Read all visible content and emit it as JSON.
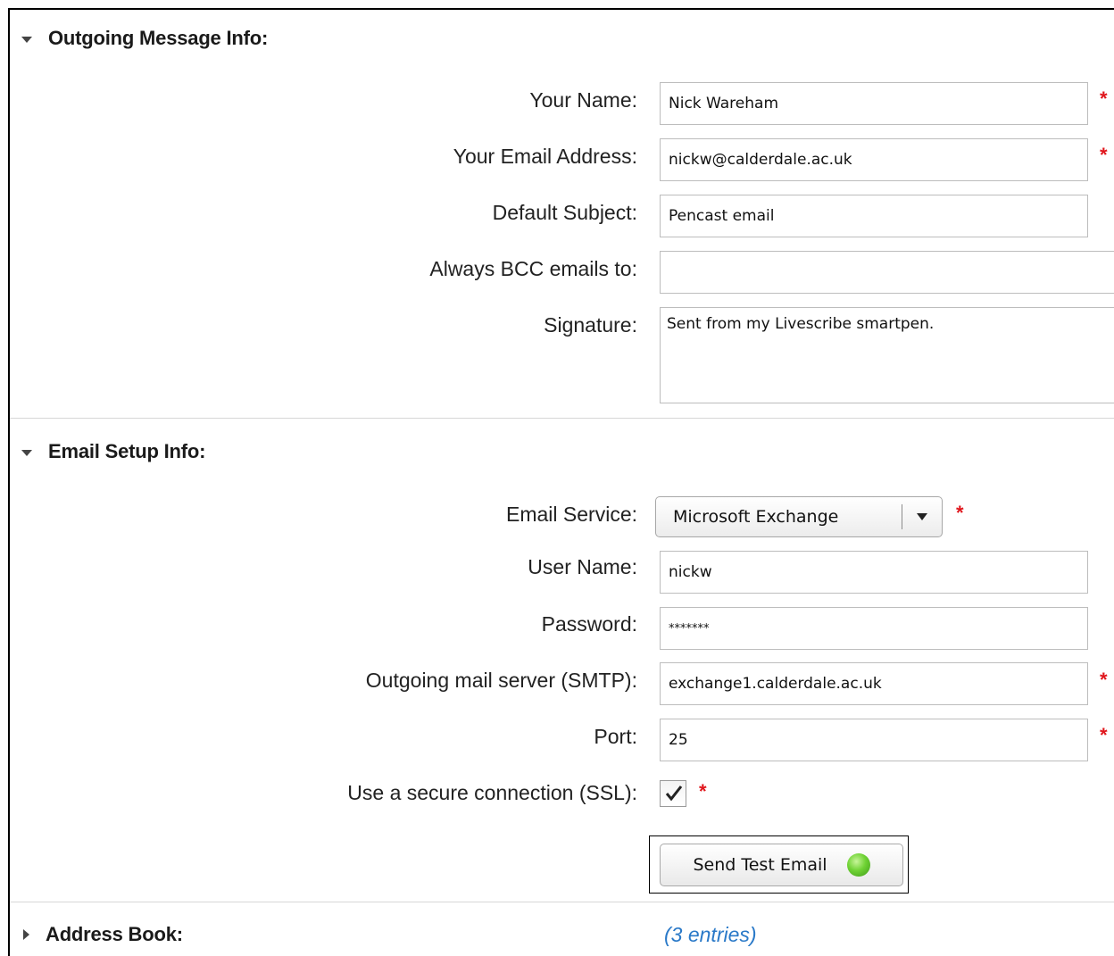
{
  "sections": {
    "outgoing": {
      "title": "Outgoing Message Info:"
    },
    "setup": {
      "title": "Email Setup Info:"
    },
    "address_book": {
      "title": "Address Book:",
      "entries_link": "(3 entries)"
    }
  },
  "outgoing": {
    "name": {
      "label": "Your Name:",
      "value": "Nick Wareham",
      "required": true
    },
    "email": {
      "label": "Your Email Address:",
      "value": "nickw@calderdale.ac.uk",
      "required": true
    },
    "subject": {
      "label": "Default Subject:",
      "value": "Pencast email"
    },
    "bcc": {
      "label": "Always BCC emails to:",
      "value": ""
    },
    "signature": {
      "label": "Signature:",
      "value": "Sent from my Livescribe smartpen."
    }
  },
  "setup": {
    "service": {
      "label": "Email Service:",
      "value": "Microsoft Exchange",
      "required": true
    },
    "username": {
      "label": "User Name:",
      "value": "nickw"
    },
    "password": {
      "label": "Password:",
      "value": "*******"
    },
    "smtp": {
      "label": "Outgoing mail server (SMTP):",
      "value": "exchange1.calderdale.ac.uk",
      "required": true
    },
    "port": {
      "label": "Port:",
      "value": "25",
      "required": true
    },
    "ssl": {
      "label": "Use a secure connection (SSL):",
      "checked": true,
      "required": true
    },
    "test_button": {
      "label": "Send Test Email",
      "status_icon": "green-status-dot"
    }
  },
  "required_mark": "*",
  "colors": {
    "required": "#e0161c",
    "link": "#2a79c8",
    "status_ok": "#6fd234"
  }
}
